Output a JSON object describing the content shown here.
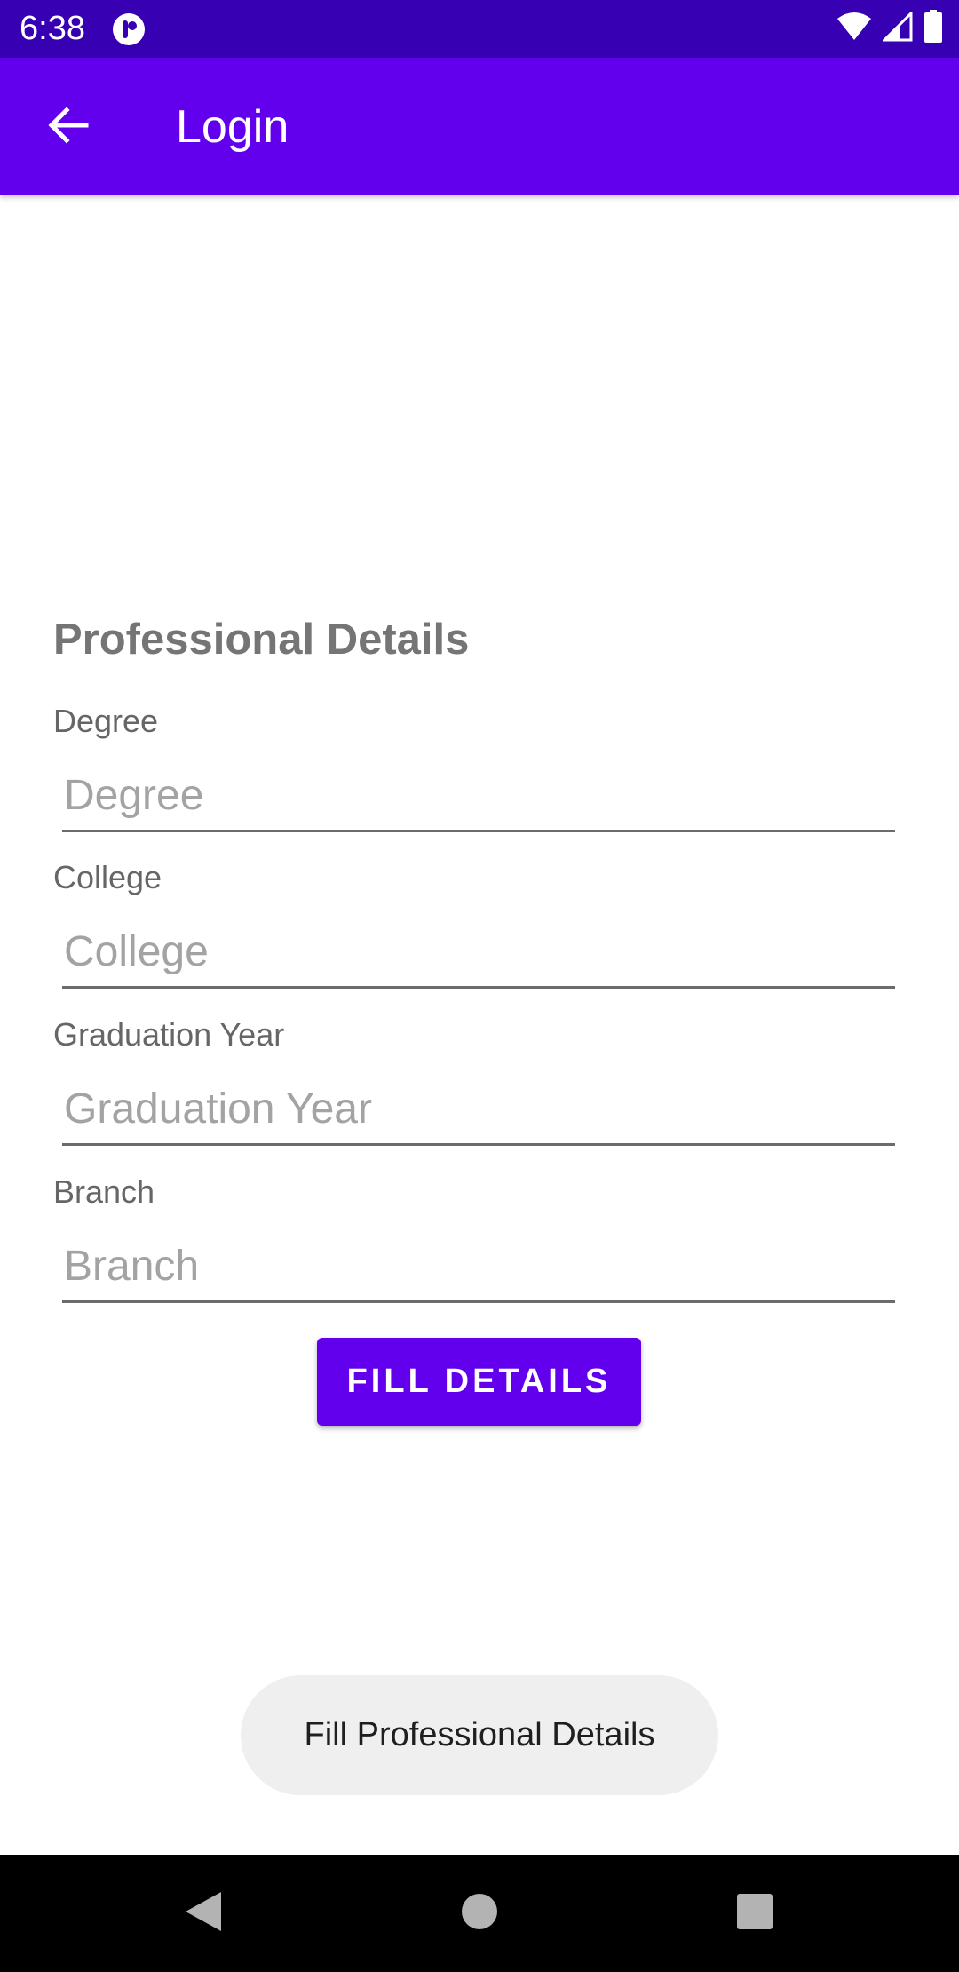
{
  "status_bar": {
    "time": "6:38",
    "icons": [
      "app-notification-icon",
      "wifi-icon",
      "cellular-signal-icon",
      "battery-icon"
    ],
    "background": "#3700b3"
  },
  "app_bar": {
    "title": "Login",
    "back_icon": "arrow-back-icon",
    "background": "#6200ee"
  },
  "form": {
    "section_title": "Professional Details",
    "fields": [
      {
        "label": "Degree",
        "placeholder": "Degree",
        "value": ""
      },
      {
        "label": "College",
        "placeholder": "College",
        "value": ""
      },
      {
        "label": "Graduation Year",
        "placeholder": "Graduation Year",
        "value": ""
      },
      {
        "label": "Branch",
        "placeholder": "Branch",
        "value": ""
      }
    ],
    "submit_label": "FILL DETAILS",
    "accent": "#6200ee"
  },
  "toast": {
    "message": "Fill Professional Details"
  },
  "nav_bar": {
    "buttons": [
      "back-triangle-icon",
      "home-circle-icon",
      "recents-square-icon"
    ]
  }
}
